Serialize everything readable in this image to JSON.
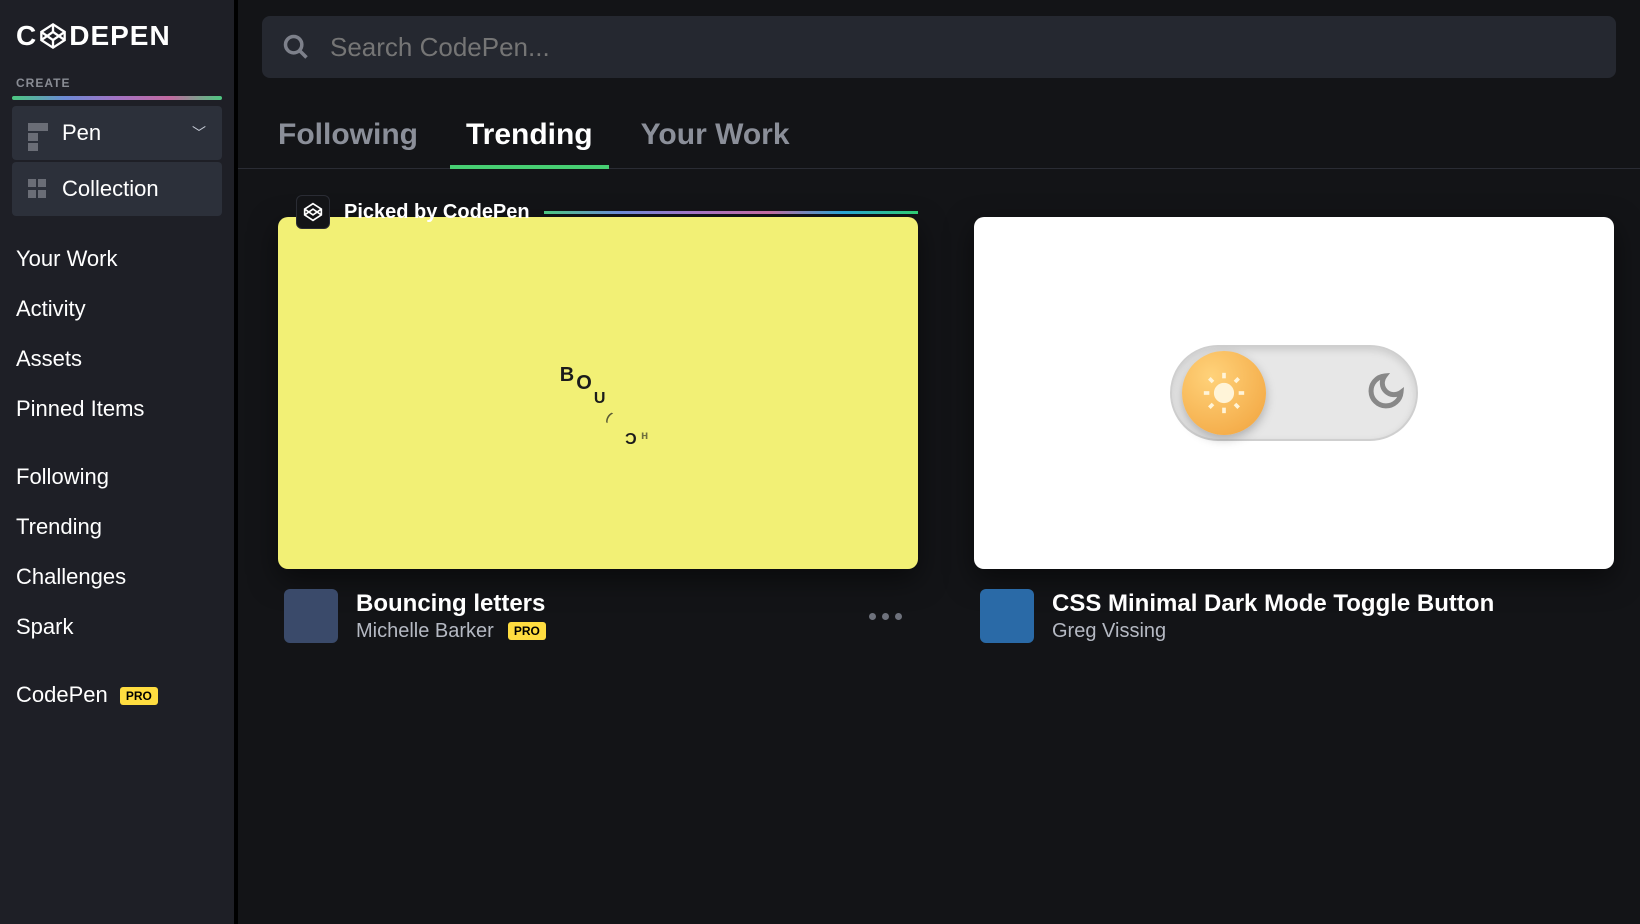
{
  "brand": "CODEPEN",
  "search": {
    "placeholder": "Search CodePen..."
  },
  "sidebar": {
    "create_label": "CREATE",
    "pen_label": "Pen",
    "collection_label": "Collection",
    "nav1": [
      "Your Work",
      "Activity",
      "Assets",
      "Pinned Items"
    ],
    "nav2": [
      "Following",
      "Trending",
      "Challenges",
      "Spark"
    ],
    "pro_label": "CodePen",
    "pro_badge": "PRO"
  },
  "tabs": {
    "items": [
      "Following",
      "Trending",
      "Your Work"
    ],
    "active_index": 1
  },
  "picked_label": "Picked by CodePen",
  "cards": [
    {
      "title": "Bouncing letters",
      "author": "Michelle Barker",
      "pro": true,
      "picked": true,
      "thumb_kind": "bounce",
      "bounce_text": "BOUNCE"
    },
    {
      "title": "CSS Minimal Dark Mode Toggle Button",
      "author": "Greg Vissing",
      "pro": false,
      "picked": false,
      "thumb_kind": "toggle"
    }
  ]
}
